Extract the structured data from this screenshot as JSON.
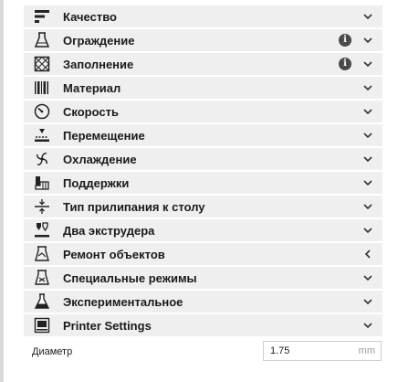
{
  "categories": [
    {
      "label": "Качество",
      "icon": "quality-icon",
      "info": false,
      "chevron": "down"
    },
    {
      "label": "Ограждение",
      "icon": "shell-icon",
      "info": true,
      "chevron": "down"
    },
    {
      "label": "Заполнение",
      "icon": "infill-icon",
      "info": true,
      "chevron": "down"
    },
    {
      "label": "Материал",
      "icon": "material-icon",
      "info": false,
      "chevron": "down"
    },
    {
      "label": "Скорость",
      "icon": "speed-icon",
      "info": false,
      "chevron": "down"
    },
    {
      "label": "Перемещение",
      "icon": "travel-icon",
      "info": false,
      "chevron": "down"
    },
    {
      "label": "Охлаждение",
      "icon": "cooling-fan-icon",
      "info": false,
      "chevron": "down"
    },
    {
      "label": "Поддержки",
      "icon": "support-icon",
      "info": false,
      "chevron": "down"
    },
    {
      "label": "Тип прилипания к столу",
      "icon": "adhesion-icon",
      "info": false,
      "chevron": "down"
    },
    {
      "label": "Два экструдера",
      "icon": "dual-extruder-icon",
      "info": false,
      "chevron": "down"
    },
    {
      "label": "Ремонт объектов",
      "icon": "mesh-fix-icon",
      "info": false,
      "chevron": "left"
    },
    {
      "label": "Специальные режимы",
      "icon": "special-modes-icon",
      "info": false,
      "chevron": "down"
    },
    {
      "label": "Экспериментальное",
      "icon": "experimental-icon",
      "info": false,
      "chevron": "down"
    },
    {
      "label": "Printer Settings",
      "icon": "printer-settings-icon",
      "info": false,
      "chevron": "down"
    }
  ],
  "info_symbol": "i",
  "diameter": {
    "label": "Диаметр",
    "value": "1.75",
    "unit": "mm"
  }
}
